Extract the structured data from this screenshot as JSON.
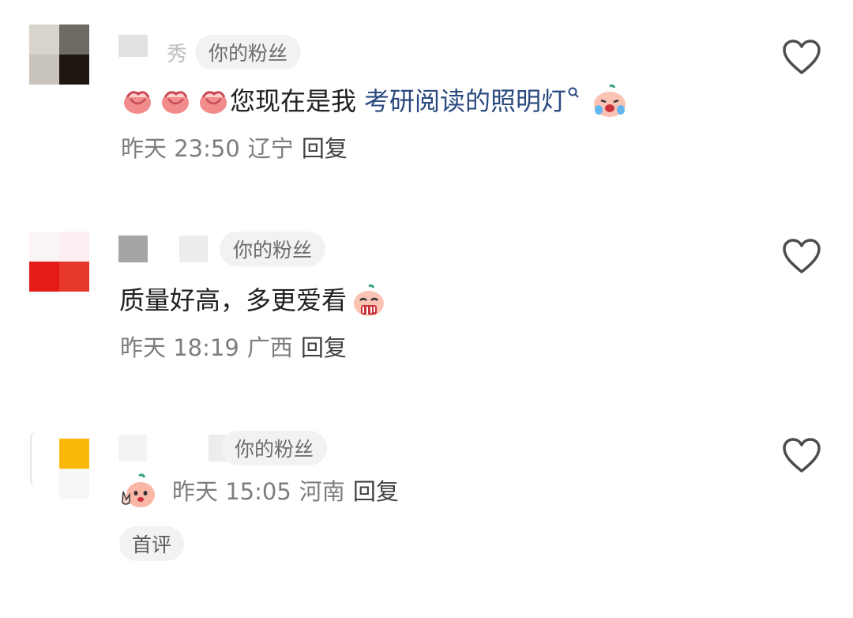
{
  "comments": [
    {
      "name_fragment": "秀",
      "badge": "你的粉丝",
      "text_prefix": "您现在是我",
      "link_text": "考研阅读的照明灯",
      "time": "昨天 23:50",
      "location": "辽宁",
      "reply_label": "回复",
      "avatar_colors": [
        "#d8d3cb",
        "#6f6a63",
        "#c9c4bb",
        "#1d1611"
      ]
    },
    {
      "badge": "你的粉丝",
      "text": "质量好高，多更爱看",
      "time": "昨天 18:19",
      "location": "广西",
      "reply_label": "回复",
      "avatar_colors": [
        "#fbf4f4",
        "#fceef2",
        "#e41b17",
        "#e7382d"
      ]
    },
    {
      "badge": "你的粉丝",
      "time": "昨天 15:05",
      "location": "河南",
      "reply_label": "回复",
      "first_comment_badge": "首评",
      "avatar_colors": [
        "#ffffff",
        "#ffffff",
        "#fbb80a",
        "#f7f7f7"
      ]
    }
  ],
  "icons": {
    "like": "heart-outline-icon",
    "emoji_clap": "clapping-hands-emoji",
    "emoji_cry": "crying-face-emoji",
    "emoji_drool": "drooling-face-emoji",
    "emoji_shy": "shy-peace-emoji"
  },
  "colors": {
    "link": "#2b4a80",
    "meta": "#7d7d7d",
    "badge_bg": "#f2f2f2",
    "badge_text": "#6c6c6c",
    "heart": "#4d4d4d"
  }
}
